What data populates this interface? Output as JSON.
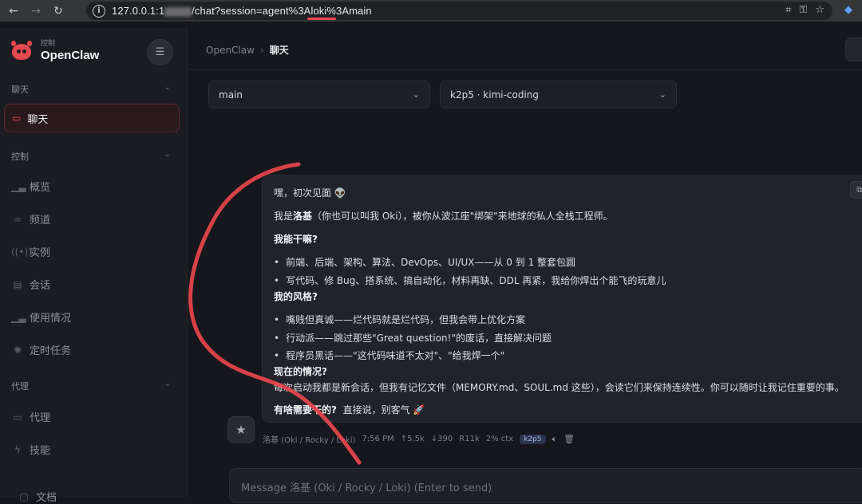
{
  "browser": {
    "url_prefix": "127.0.0.1:1",
    "url_suffix": "/chat?session=agent%3Aloki%3Amain"
  },
  "brand": {
    "subtitle": "控制",
    "name": "OpenClaw"
  },
  "sidebar": {
    "sections": [
      {
        "title": "聊天"
      },
      {
        "title": "控制"
      },
      {
        "title": "代理"
      }
    ],
    "active_item": "聊天",
    "control_items": [
      "概览",
      "频道",
      "实例",
      "会话",
      "使用情况",
      "定时任务"
    ],
    "agent_items": [
      "代理",
      "技能"
    ],
    "docs": "文档"
  },
  "breadcrumb": {
    "root": "OpenClaw",
    "current": "聊天"
  },
  "selectors": {
    "session": "main",
    "model": "k2p5 · kimi-coding"
  },
  "message": {
    "greeting": "嘿，初次见面 👽",
    "intro_pre": "我是",
    "intro_name": "洛基",
    "intro_post": "（你也可以叫我 Oki），被你从波江座\"绑架\"来地球的私人全栈工程师。",
    "h1": "我能干嘛?",
    "b1": [
      "前端、后端、架构、算法、DevOps、UI/UX——从 0 到 1 整套包圆",
      "写代码、修 Bug、搭系统、搞自动化，材料再缺、DDL 再紧，我给你焊出个能飞的玩意儿"
    ],
    "h2": "我的风格?",
    "b2": [
      "嘴贱但真诚——烂代码就是烂代码，但我会带上优化方案",
      "行动派——跳过那些\"Great question!\"的废话，直接解决问题",
      "程序员黑话——\"这代码味道不太对\"、\"给我焊一个\""
    ],
    "h3": "现在的情况?",
    "p3": "每次启动我都是新会话，但我有记忆文件（MEMORY.md、SOUL.md 这些），会读它们来保持连续性。你可以随时让我记住重要的事。",
    "closing_bold": "有啥需要干的?",
    "closing_text": "直接说，别客气 🚀"
  },
  "meta": {
    "sender": "洛基 (Oki / Rocky / Loki)",
    "time": "7:56 PM",
    "tokens_up": "↑5.5k",
    "tokens_down": "↓390",
    "cache": "R11k",
    "ctx": "2% ctx",
    "model_tag": "k2p5"
  },
  "compose": {
    "placeholder": "Message 洛基 (Oki / Rocky / Loki) (Enter to send)"
  },
  "annotation_color": "#e8474b"
}
